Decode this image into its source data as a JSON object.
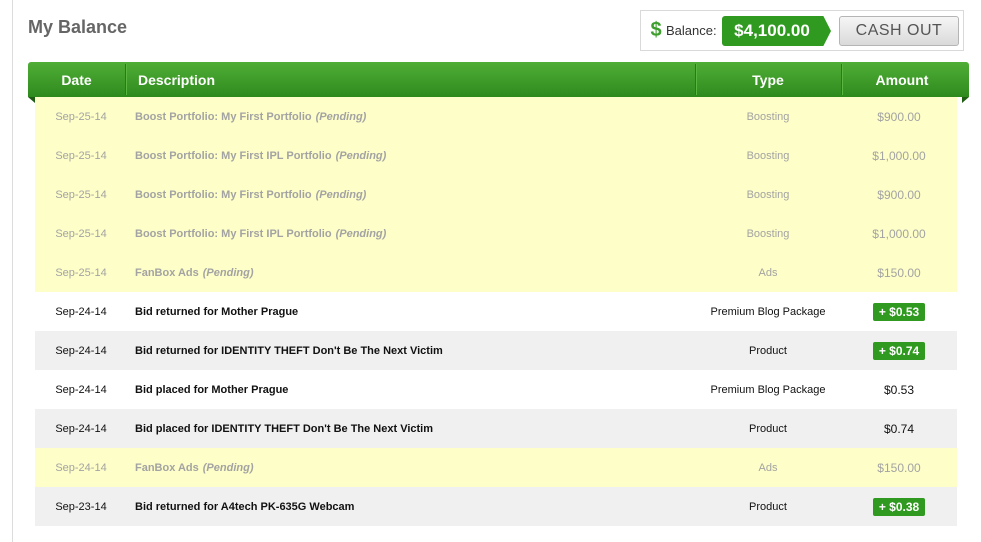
{
  "page": {
    "title": "My Balance"
  },
  "balance": {
    "icon": "dollar-icon",
    "label": "Balance:",
    "value": "$4,100.00",
    "cashout_label": "CASH OUT"
  },
  "colors": {
    "accent_green": "#2f9a1f",
    "pending_bg": "#fefec8",
    "header_green": "#3f9c2a"
  },
  "table": {
    "headers": {
      "date": "Date",
      "description": "Description",
      "type": "Type",
      "amount": "Amount"
    },
    "pending_label": "(Pending)",
    "rows": [
      {
        "date": "Sep-25-14",
        "description": "Boost Portfolio: My First Portfolio",
        "pending": true,
        "type": "Boosting",
        "amount": "$900.00",
        "credit": false,
        "style": "pending"
      },
      {
        "date": "Sep-25-14",
        "description": "Boost Portfolio: My First IPL Portfolio",
        "pending": true,
        "type": "Boosting",
        "amount": "$1,000.00",
        "credit": false,
        "style": "pending"
      },
      {
        "date": "Sep-25-14",
        "description": "Boost Portfolio: My First Portfolio",
        "pending": true,
        "type": "Boosting",
        "amount": "$900.00",
        "credit": false,
        "style": "pending"
      },
      {
        "date": "Sep-25-14",
        "description": "Boost Portfolio: My First IPL Portfolio",
        "pending": true,
        "type": "Boosting",
        "amount": "$1,000.00",
        "credit": false,
        "style": "pending"
      },
      {
        "date": "Sep-25-14",
        "description": "FanBox Ads",
        "pending": true,
        "type": "Ads",
        "amount": "$150.00",
        "credit": false,
        "style": "pending"
      },
      {
        "date": "Sep-24-14",
        "description": "Bid returned for Mother Prague",
        "pending": false,
        "type": "Premium Blog Package",
        "amount": "+ $0.53",
        "credit": true,
        "style": "white"
      },
      {
        "date": "Sep-24-14",
        "description": "Bid returned for IDENTITY THEFT Don't Be The Next Victim",
        "pending": false,
        "type": "Product",
        "amount": "+ $0.74",
        "credit": true,
        "style": "grey"
      },
      {
        "date": "Sep-24-14",
        "description": "Bid placed for Mother Prague",
        "pending": false,
        "type": "Premium Blog Package",
        "amount": "$0.53",
        "credit": false,
        "style": "white"
      },
      {
        "date": "Sep-24-14",
        "description": "Bid placed for IDENTITY THEFT Don't Be The Next Victim",
        "pending": false,
        "type": "Product",
        "amount": "$0.74",
        "credit": false,
        "style": "grey"
      },
      {
        "date": "Sep-24-14",
        "description": "FanBox Ads",
        "pending": true,
        "type": "Ads",
        "amount": "$150.00",
        "credit": false,
        "style": "pending"
      },
      {
        "date": "Sep-23-14",
        "description": "Bid returned for A4tech PK-635G Webcam",
        "pending": false,
        "type": "Product",
        "amount": "+ $0.38",
        "credit": true,
        "style": "grey"
      }
    ]
  }
}
